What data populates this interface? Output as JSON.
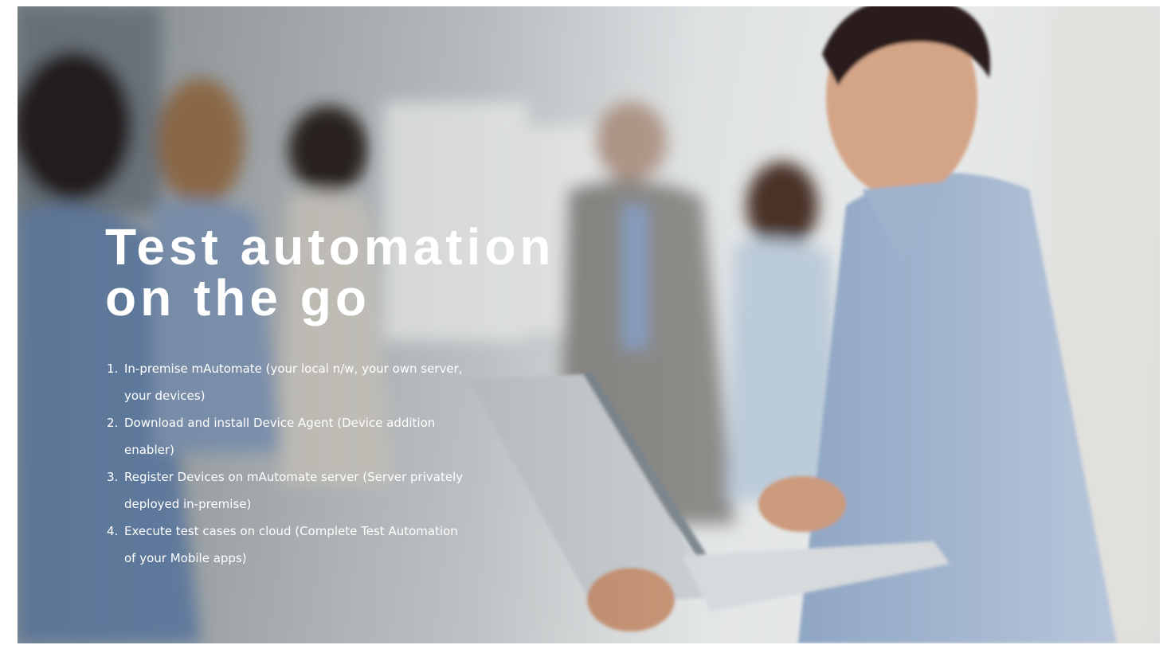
{
  "slide": {
    "headline": "Test automation on the go",
    "steps": [
      {
        "number": "1.",
        "text": "In-premise mAutomate (your local n/w, your own server, your devices)"
      },
      {
        "number": "2.",
        "text": "Download and install Device Agent (Device addition enabler)"
      },
      {
        "number": "3.",
        "text": "Register Devices on mAutomate server (Server privately deployed in-premise)"
      },
      {
        "number": "4.",
        "text": "Execute test cases on cloud (Complete Test Automation of your Mobile apps)"
      }
    ],
    "background_image": "office-photo-man-holding-laptop",
    "text_color": "#ffffff"
  }
}
